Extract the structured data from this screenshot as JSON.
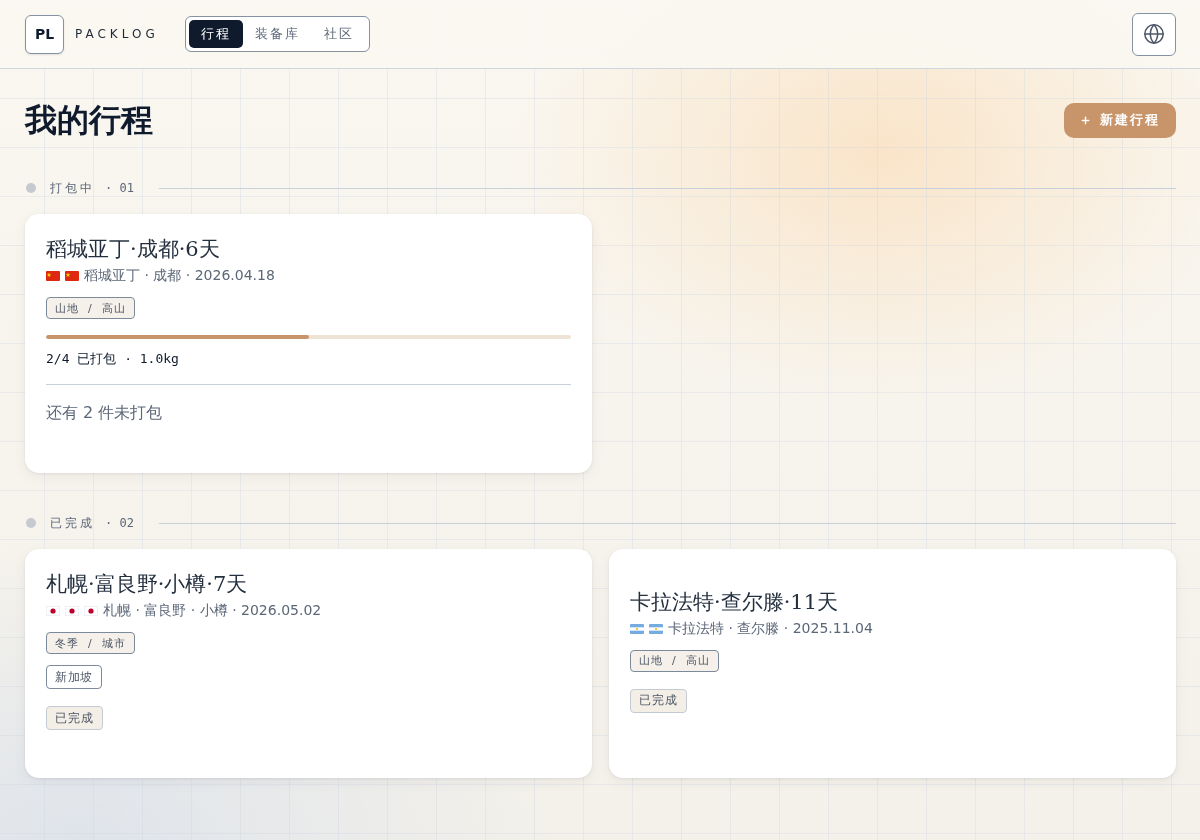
{
  "header": {
    "logo": "PL",
    "brand": "PACKLOG",
    "tabs": [
      {
        "label": "行程",
        "selected": true
      },
      {
        "label": "装备库",
        "selected": false
      },
      {
        "label": "社区",
        "selected": false
      }
    ]
  },
  "page": {
    "title": "我的行程",
    "new_button": "新建行程"
  },
  "sections": [
    {
      "label": "打包中",
      "count": "· 01",
      "trips": [
        {
          "title": "稻城亚丁·成都·6天",
          "flags": [
            {
              "kind": "cn"
            },
            {
              "kind": "cn"
            }
          ],
          "meta": "稻城亚丁 · 成都 · 2026.04.18",
          "tags": [
            {
              "kind": "category",
              "label": "山地  /  高山"
            }
          ],
          "progress": {
            "level": 0.5,
            "summary": "2/4 已打包 · 1.0kg",
            "note": "还有 2 件未打包"
          }
        }
      ]
    },
    {
      "label": "已完成",
      "count": "· 02",
      "trips": [
        {
          "title": "札幌·富良野·小樽·7天",
          "flags": [
            {
              "kind": "jp"
            },
            {
              "kind": "jp"
            },
            {
              "kind": "jp"
            }
          ],
          "meta": "札幌 · 富良野 · 小樽 · 2026.05.02",
          "tags": [
            {
              "kind": "category",
              "label": "冬季  /  城市"
            },
            {
              "kind": "place",
              "label": "新加坡"
            },
            {
              "kind": "status",
              "label": "已完成"
            }
          ]
        },
        {
          "title": "卡拉法特·查尔滕·11天",
          "flags": [
            {
              "kind": "ar"
            },
            {
              "kind": "ar"
            }
          ],
          "meta": "卡拉法特 · 查尔滕 · 2025.11.04",
          "tags": [
            {
              "kind": "category",
              "label": "山地  /  高山"
            },
            {
              "kind": "status",
              "label": "已完成"
            }
          ]
        }
      ]
    }
  ]
}
